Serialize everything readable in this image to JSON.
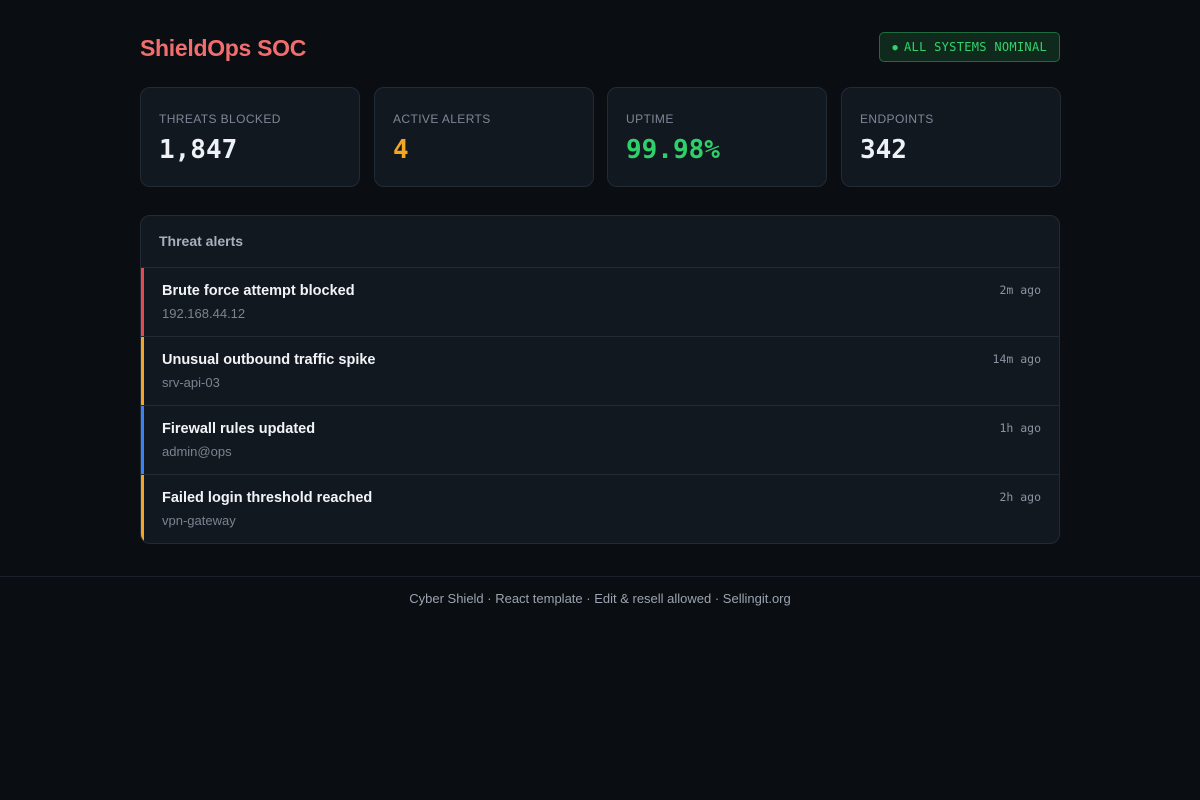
{
  "header": {
    "brand": "ShieldOps SOC",
    "status": "ALL SYSTEMS NOMINAL",
    "status_dot": "●"
  },
  "stats": [
    {
      "label": "THREATS BLOCKED",
      "value": "1,847",
      "color": "#eef1f5"
    },
    {
      "label": "ACTIVE ALERTS",
      "value": "4",
      "color": "#f5a524"
    },
    {
      "label": "UPTIME",
      "value": "99.98%",
      "color": "#2fcf6a"
    },
    {
      "label": "ENDPOINTS",
      "value": "342",
      "color": "#eef1f5"
    }
  ],
  "alerts": {
    "title": "Threat alerts",
    "items": [
      {
        "title": "Brute force attempt blocked",
        "source": "192.168.44.12",
        "time": "2m ago",
        "severity_color": "#e5484d"
      },
      {
        "title": "Unusual outbound traffic spike",
        "source": "srv-api-03",
        "time": "14m ago",
        "severity_color": "#f5a524"
      },
      {
        "title": "Firewall rules updated",
        "source": "admin@ops",
        "time": "1h ago",
        "severity_color": "#3b82f6"
      },
      {
        "title": "Failed login threshold reached",
        "source": "vpn-gateway",
        "time": "2h ago",
        "severity_color": "#f5a524"
      }
    ]
  },
  "footer": {
    "text": "Cyber Shield · React template · Edit & resell allowed · Sellingit.org"
  },
  "colors": {
    "background": "#0a0d12",
    "card": "#121820",
    "brand": "#f26d6d",
    "status_green": "#34d26c"
  }
}
